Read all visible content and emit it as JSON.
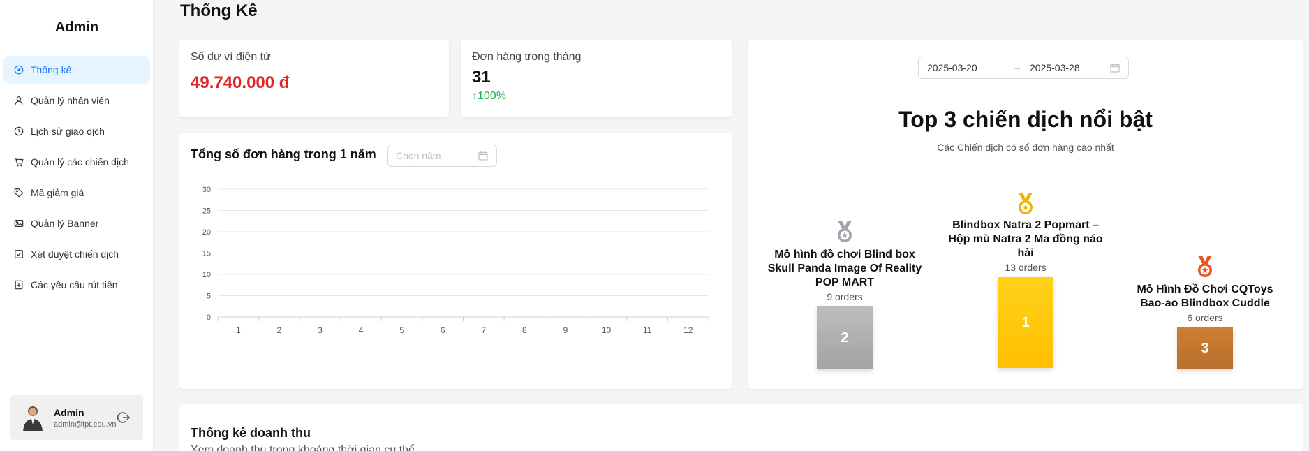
{
  "sidebar": {
    "brand": "Admin",
    "items": [
      {
        "label": "Thống kê",
        "icon": "dashboard-icon",
        "active": true
      },
      {
        "label": "Quản lý nhân viên",
        "icon": "user-icon"
      },
      {
        "label": "Lịch sử giao dịch",
        "icon": "history-icon"
      },
      {
        "label": "Quản lý các chiến dịch",
        "icon": "cart-icon"
      },
      {
        "label": "Mã giảm giá",
        "icon": "tag-icon"
      },
      {
        "label": "Quản lý Banner",
        "icon": "image-icon"
      },
      {
        "label": "Xét duyệt chiến dịch",
        "icon": "check-square-icon"
      },
      {
        "label": "Các yêu cầu rút tiền",
        "icon": "withdraw-icon"
      }
    ],
    "user": {
      "name": "Admin",
      "email": "admin@fpt.edu.vn"
    }
  },
  "page_title": "Thống Kê",
  "wallet": {
    "label": "Số dư ví điện tử",
    "value": "49.740.000 đ"
  },
  "orders_month": {
    "label": "Đơn hàng trong tháng",
    "value": "31",
    "delta": "↑100%"
  },
  "orders_chart": {
    "title": "Tổng số đơn hàng trong 1 năm",
    "year_placeholder": "Chọn năm"
  },
  "chart_data": {
    "type": "line",
    "title": "Tổng số đơn hàng trong 1 năm",
    "categories": [
      "1",
      "2",
      "3",
      "4",
      "5",
      "6",
      "7",
      "8",
      "9",
      "10",
      "11",
      "12"
    ],
    "series": [
      {
        "values": []
      }
    ],
    "yticks": [
      "0",
      "5",
      "10",
      "15",
      "20",
      "25",
      "30"
    ],
    "ylim": [
      0,
      30
    ],
    "grid": true
  },
  "top_campaigns": {
    "date_from": "2025-03-20",
    "date_arrow": "→",
    "date_to": "2025-03-28",
    "title": "Top 3 chiến dịch nổi bật",
    "subtitle": "Các Chiến dịch có số đơn hàng cao nhất",
    "first": {
      "name": "Blindbox Natra 2 Popmart – Hộp mù Natra 2 Ma đồng náo hải",
      "orders": "13 orders",
      "rank": "1",
      "color": "#ffc400"
    },
    "second": {
      "name": "Mô hình đồ chơi Blind box Skull Panda Image Of Reality POP MART",
      "orders": "9 orders",
      "rank": "2",
      "color": "#a8a8a8"
    },
    "third": {
      "name": "Mô Hình Đồ Chơi CQToys Bao-ao Blindbox Cuddle",
      "orders": "6 orders",
      "rank": "3",
      "color": "#c87533"
    }
  },
  "revenue": {
    "title": "Thống kê doanh thu",
    "subtitle": "Xem doanh thu trong khoảng thời gian cụ thể"
  }
}
